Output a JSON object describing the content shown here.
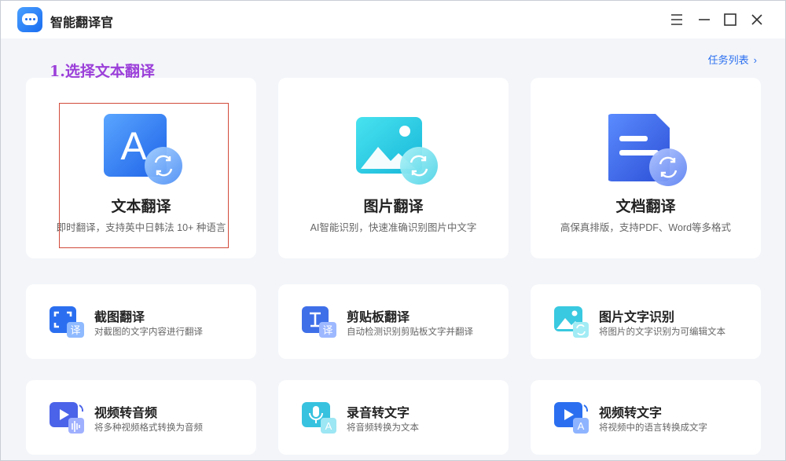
{
  "app": {
    "title": "智能翻译官"
  },
  "window_controls": [
    "menu",
    "minimize",
    "maximize",
    "close"
  ],
  "section": {
    "title": "1.选择文本翻译"
  },
  "task_list": {
    "label": "任务列表",
    "chevron": "›"
  },
  "big_cards": [
    {
      "id": "text",
      "title": "文本翻译",
      "desc": "即时翻译，支持英中日韩法 10+ 种语言",
      "icon": "letter-a-icon"
    },
    {
      "id": "image",
      "title": "图片翻译",
      "desc": "AI智能识别，快速准确识别图片中文字",
      "icon": "picture-icon"
    },
    {
      "id": "doc",
      "title": "文档翻译",
      "desc": "高保真排版，支持PDF、Word等多格式",
      "icon": "document-icon"
    }
  ],
  "small_cards": [
    {
      "id": "screenshot",
      "title": "截图翻译",
      "desc": "对截图的文字内容进行翻译",
      "icon": "screenshot-icon",
      "badge": "译"
    },
    {
      "id": "clipboard",
      "title": "剪贴板翻译",
      "desc": "自动检测识别剪贴板文字并翻译",
      "icon": "clipboard-icon",
      "badge": "译"
    },
    {
      "id": "ocr",
      "title": "图片文字识别",
      "desc": "将图片的文字识别为可编辑文本",
      "icon": "image-ocr-icon"
    },
    {
      "id": "video-audio",
      "title": "视频转音频",
      "desc": "将多种视频格式转换为音频",
      "icon": "video-to-audio-icon"
    },
    {
      "id": "record-text",
      "title": "录音转文字",
      "desc": "将音频转换为文本",
      "icon": "microphone-icon",
      "badge": "A"
    },
    {
      "id": "video-text",
      "title": "视频转文字",
      "desc": "将视频中的语言转换成文字",
      "icon": "video-to-text-icon",
      "badge": "A"
    }
  ],
  "colors": {
    "accent": "#2b6ff0",
    "section_title": "#9b3fd9",
    "highlight": "#d24a3a"
  }
}
